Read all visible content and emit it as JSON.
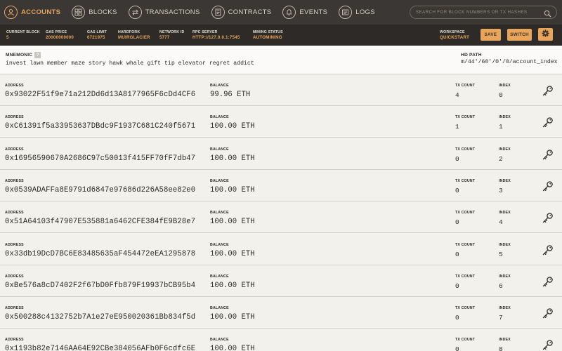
{
  "nav": {
    "items": [
      {
        "label": "ACCOUNTS",
        "icon": "accounts-icon",
        "active": true
      },
      {
        "label": "BLOCKS",
        "icon": "blocks-icon",
        "active": false
      },
      {
        "label": "TRANSACTIONS",
        "icon": "transactions-icon",
        "active": false
      },
      {
        "label": "CONTRACTS",
        "icon": "contracts-icon",
        "active": false
      },
      {
        "label": "EVENTS",
        "icon": "events-icon",
        "active": false
      },
      {
        "label": "LOGS",
        "icon": "logs-icon",
        "active": false
      }
    ],
    "search_placeholder": "SEARCH FOR BLOCK NUMBERS OR TX HASHES"
  },
  "status": {
    "current_block_label": "CURRENT BLOCK",
    "current_block": "5",
    "gas_price_label": "GAS PRICE",
    "gas_price": "20000000000",
    "gas_limit_label": "GAS LIMIT",
    "gas_limit": "6721975",
    "hardfork_label": "HARDFORK",
    "hardfork": "MUIRGLACIER",
    "network_id_label": "NETWORK ID",
    "network_id": "5777",
    "rpc_server_label": "RPC SERVER",
    "rpc_server": "HTTP://127.0.0.1:7545",
    "mining_status_label": "MINING STATUS",
    "mining_status": "AUTOMINING",
    "workspace_label": "WORKSPACE",
    "workspace": "QUICKSTART",
    "save_label": "SAVE",
    "switch_label": "SWITCH"
  },
  "mnemonic": {
    "label": "MNEMONIC",
    "help": "?",
    "words": "invest lawn member maze story hawk whale gift tip elevator regret addict",
    "hd_path_label": "HD PATH",
    "hd_path": "m/44'/60'/0'/0/account_index"
  },
  "labels": {
    "address": "ADDRESS",
    "balance": "BALANCE",
    "tx_count": "TX COUNT",
    "index": "INDEX"
  },
  "accounts": [
    {
      "address": "0x93022F51f9e71a212Dd6d13A8177965F6cDd4CF6",
      "balance": "99.96 ETH",
      "tx_count": "4",
      "index": "0"
    },
    {
      "address": "0xC61391f5a33953637DBdc9F1937C681C240f5671",
      "balance": "100.00 ETH",
      "tx_count": "1",
      "index": "1"
    },
    {
      "address": "0x16956590670A2686C97c50013f415FF70fF7db47",
      "balance": "100.00 ETH",
      "tx_count": "0",
      "index": "2"
    },
    {
      "address": "0x0539ADAFFa8E9791d6847e97686d226A58ee82e0",
      "balance": "100.00 ETH",
      "tx_count": "0",
      "index": "3"
    },
    {
      "address": "0x51A64103f47907E535881a6462CFE384fE9B28e7",
      "balance": "100.00 ETH",
      "tx_count": "0",
      "index": "4"
    },
    {
      "address": "0x33db19DcD7BC6E83485635aF454472eEA1295878",
      "balance": "100.00 ETH",
      "tx_count": "0",
      "index": "5"
    },
    {
      "address": "0xBe576a8cD7402F2f67bD0Ffb879F19937bCB95b4",
      "balance": "100.00 ETH",
      "tx_count": "0",
      "index": "6"
    },
    {
      "address": "0x500288c4132752b7A1e27eE950020361Bb834f5d",
      "balance": "100.00 ETH",
      "tx_count": "0",
      "index": "7"
    },
    {
      "address": "0x1193b82e7146AA64E92CBe384056AFb0F6cdfc6E",
      "balance": "100.00 ETH",
      "tx_count": "0",
      "index": "8"
    }
  ],
  "colors": {
    "accent": "#e8a55c",
    "nav_bg": "#3a3734",
    "status_bg": "#2d2a27",
    "page_bg": "#f3f1ec"
  }
}
